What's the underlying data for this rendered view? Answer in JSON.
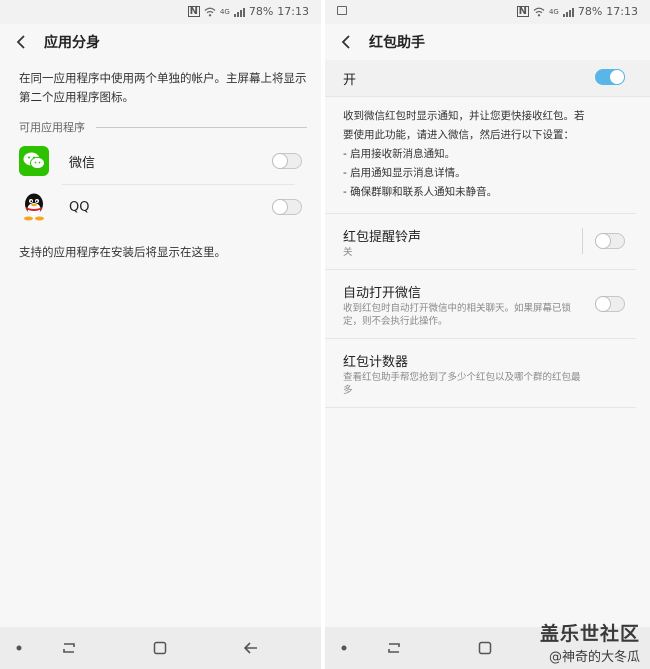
{
  "status": {
    "nfc": "N",
    "network": "4G",
    "battery": "78%",
    "time": "17:13"
  },
  "left": {
    "title": "应用分身",
    "description": "在同一应用程序中使用两个单独的帐户。主屏幕上将显示第二个应用程序图标。",
    "section_label": "可用应用程序",
    "apps": [
      {
        "name": "微信",
        "enabled": false,
        "icon": "wechat-icon"
      },
      {
        "name": "QQ",
        "enabled": false,
        "icon": "qq-icon"
      }
    ],
    "footer_note": "支持的应用程序在安装后将显示在这里。"
  },
  "right": {
    "title": "红包助手",
    "master_label": "开",
    "master_on": true,
    "info_lines": [
      "收到微信红包时显示通知，并让您更快接收红包。若",
      "要使用此功能，请进入微信，然后进行以下设置：",
      "- 启用接收新消息通知。",
      "- 启用通知显示消息详情。",
      "- 确保群聊和联系人通知未静音。"
    ],
    "settings": [
      {
        "title": "红包提醒铃声",
        "subtitle": "关",
        "has_toggle": true,
        "on": false
      },
      {
        "title": "自动打开微信",
        "subtitle": "收到红包时自动打开微信中的相关聊天。如果屏幕已锁定，则不会执行此操作。",
        "has_toggle": true,
        "on": false
      },
      {
        "title": "红包计数器",
        "subtitle": "查看红包助手帮您抢到了多少个红包以及哪个群的红包最多",
        "has_toggle": false
      }
    ]
  },
  "watermark": {
    "brand": "盖乐世社区",
    "user": "@神奇的大冬瓜"
  },
  "colors": {
    "accent": "#59b6e6",
    "background": "#f7f7f7",
    "wechat": "#2dc100"
  }
}
